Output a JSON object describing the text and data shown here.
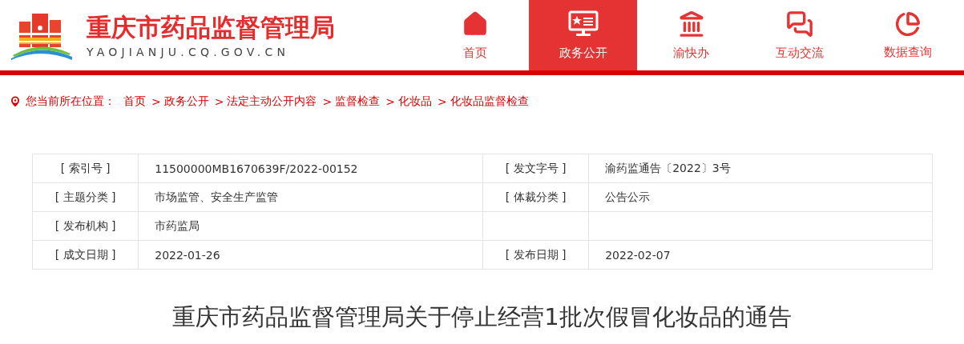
{
  "header": {
    "site_name": "重庆市药品监督管理局",
    "domain": "YAOJIANJU.CQ.GOV.CN"
  },
  "nav": [
    {
      "label": "首页",
      "selected": false
    },
    {
      "label": "政务公开",
      "selected": true
    },
    {
      "label": "渝快办",
      "selected": false
    },
    {
      "label": "互动交流",
      "selected": false
    },
    {
      "label": "数据查询",
      "selected": false
    }
  ],
  "breadcrumb": {
    "label": "您当前所在位置：",
    "separator": ">",
    "items": [
      "首页",
      "政务公开",
      "法定主动公开内容",
      "监督检查",
      "化妆品",
      "化妆品监督检查"
    ]
  },
  "info_table": [
    [
      {
        "label": "[ 索引号 ]",
        "value": "11500000MB1670639F/2022-00152"
      },
      {
        "label": "[ 发文字号 ]",
        "value": "渝药监通告〔2022〕3号"
      }
    ],
    [
      {
        "label": "[ 主题分类 ]",
        "value": "市场监管、安全生产监管"
      },
      {
        "label": "[ 体裁分类 ]",
        "value": "公告公示"
      }
    ],
    [
      {
        "label": "[ 发布机构 ]",
        "value": "市药监局"
      }
    ],
    [
      {
        "label": "[ 成文日期 ]",
        "value": "2022-01-26"
      },
      {
        "label": "[ 发布日期 ]",
        "value": "2022-02-07"
      }
    ]
  ],
  "article_title": "重庆市药品监督管理局关于停止经营1批次假冒化妆品的通告"
}
